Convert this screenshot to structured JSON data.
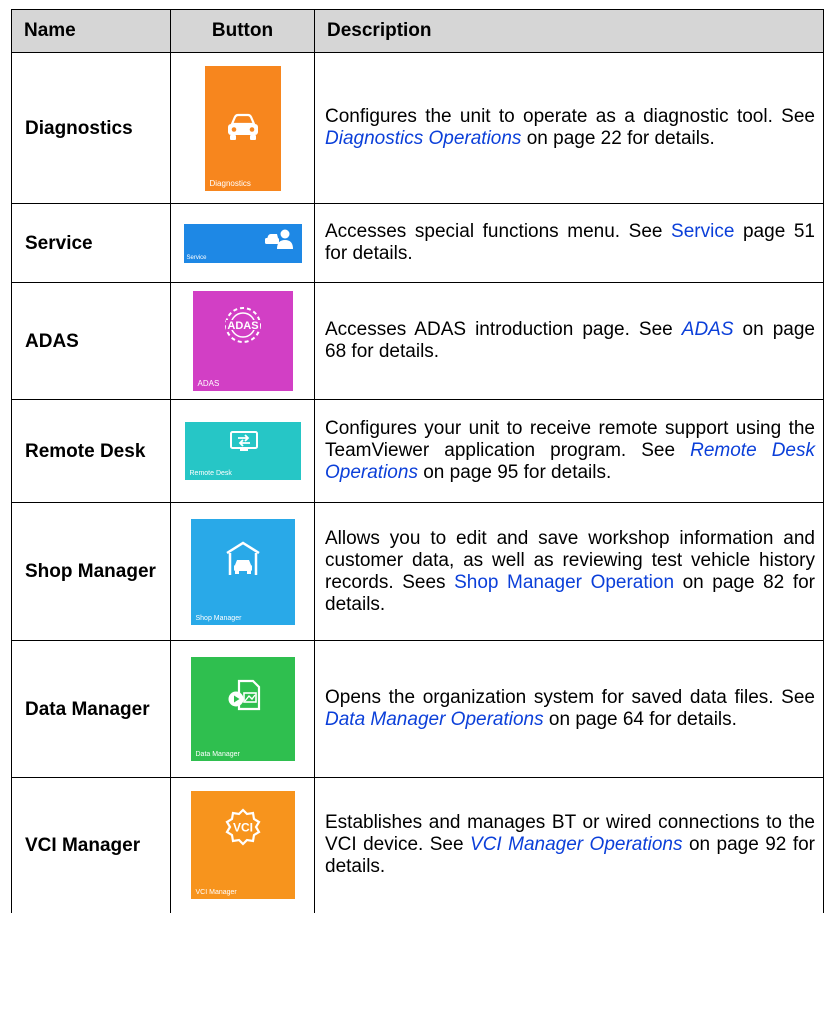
{
  "headers": {
    "name": "Name",
    "button": "Button",
    "description": "Description"
  },
  "rows": [
    {
      "name": "Diagnostics",
      "tile_label": "Diagnostics",
      "icon": "car-front-icon",
      "color": "#f7861e",
      "desc_pre": "Configures the unit to operate as a diagnostic tool. See ",
      "link": "Diagnostics Operations",
      "link_italic": true,
      "desc_post": " on page 22 for details."
    },
    {
      "name": "Service",
      "tile_label": "Service",
      "icon": "service-technician-icon",
      "color": "#1e88e5",
      "desc_pre": "Accesses special functions menu. See ",
      "link": "Service",
      "link_italic": false,
      "desc_post": " page 51 for details."
    },
    {
      "name": "ADAS",
      "tile_label": "ADAS",
      "icon": "adas-icon",
      "color": "#d23fc5",
      "desc_pre": "Accesses ADAS introduction page. See ",
      "link": "ADAS",
      "link_italic": true,
      "desc_post": " on page 68 for details."
    },
    {
      "name": "Remote Desk",
      "tile_label": "Remote Desk",
      "icon": "remote-desk-icon",
      "color": "#26c6c6",
      "desc_pre": "Configures your unit to receive remote support using the TeamViewer application program. See ",
      "link": "Remote Desk Operations",
      "link_italic": true,
      "desc_post": " on page 95 for details."
    },
    {
      "name": "Shop Manager",
      "tile_label": "Shop Manager",
      "icon": "garage-icon",
      "color": "#29a9e8",
      "desc_pre": "Allows you to edit and save workshop information and customer data, as well as reviewing test vehicle history records. Sees ",
      "link": "Shop Manager Operation",
      "link_italic": false,
      "desc_post": " on page 82 for details."
    },
    {
      "name": "Data Manager",
      "tile_label": "Data Manager",
      "icon": "data-files-icon",
      "color": "#2fbf4f",
      "desc_pre": "Opens the organization system for saved data files. See ",
      "link": "Data Manager Operations",
      "link_italic": true,
      "desc_post": " on page 64 for details."
    },
    {
      "name": "VCI Manager",
      "tile_label": "VCI Manager",
      "icon": "vci-gear-icon",
      "color": "#f7941d",
      "desc_pre": "Establishes and manages BT or wired connections to the VCI device. See ",
      "link": "VCI Manager Operations",
      "link_italic": true,
      "desc_post": " on page 92 for details."
    }
  ]
}
